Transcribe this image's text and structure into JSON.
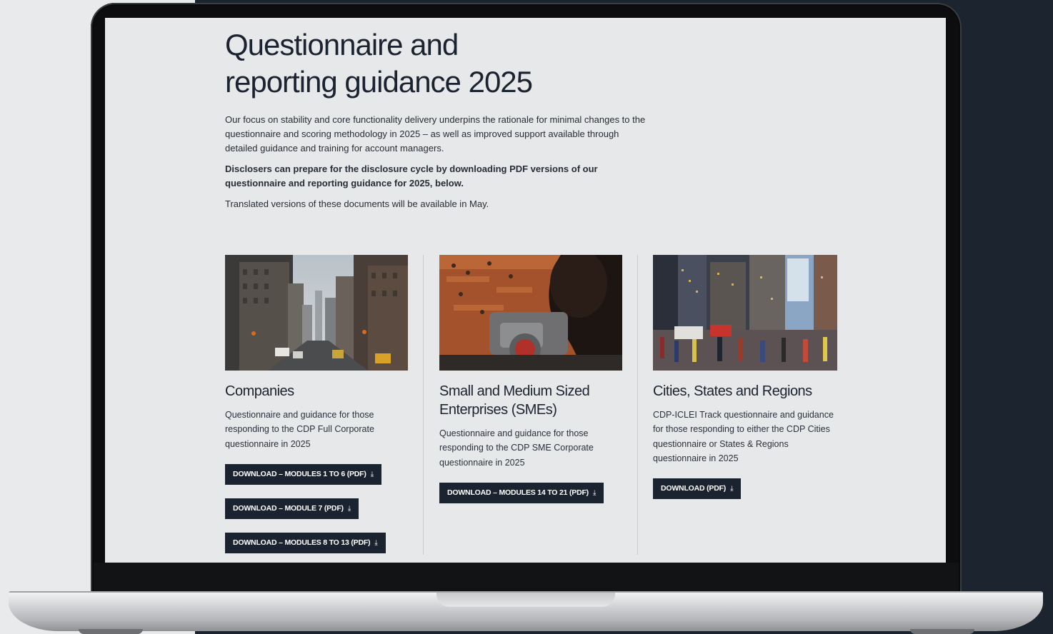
{
  "page": {
    "title_line1": "Questionnaire and",
    "title_line2": "reporting guidance 2025",
    "intro_p1": "Our focus on stability and core functionality delivery underpins the rationale for minimal changes to the questionnaire and scoring methodology in 2025 – as well as improved support available through detailed guidance and training for account managers.",
    "intro_p2": "Disclosers can prepare for the disclosure cycle by downloading PDF versions of our questionnaire and reporting guidance for 2025, below.",
    "intro_p3": "Translated versions of these documents will be available in May."
  },
  "cards": [
    {
      "title": "Companies",
      "description": "Questionnaire and guidance for those responding to the CDP Full Corporate questionnaire in 2025",
      "buttons": [
        "DOWNLOAD – MODULES 1 TO 6 (PDF)",
        "DOWNLOAD – MODULE 7 (PDF)",
        "DOWNLOAD – MODULES 8 TO 13 (PDF)"
      ]
    },
    {
      "title": "Small and Medium Sized Enterprises (SMEs)",
      "description": "Questionnaire and guidance for those responding to the CDP SME Corporate questionnaire in 2025",
      "buttons": [
        "DOWNLOAD – MODULES 14 TO 21 (PDF)"
      ]
    },
    {
      "title": "Cities, States and Regions",
      "description": "CDP-ICLEI Track questionnaire and guidance for those responding to either the CDP Cities questionnaire or States & Regions questionnaire in 2025",
      "buttons": [
        "DOWNLOAD (PDF)"
      ]
    }
  ],
  "icons": {
    "download": "download-icon"
  },
  "colors": {
    "button_bg": "#1b2330",
    "text": "#1b2330",
    "screen_bg": "#e7e8e9"
  }
}
